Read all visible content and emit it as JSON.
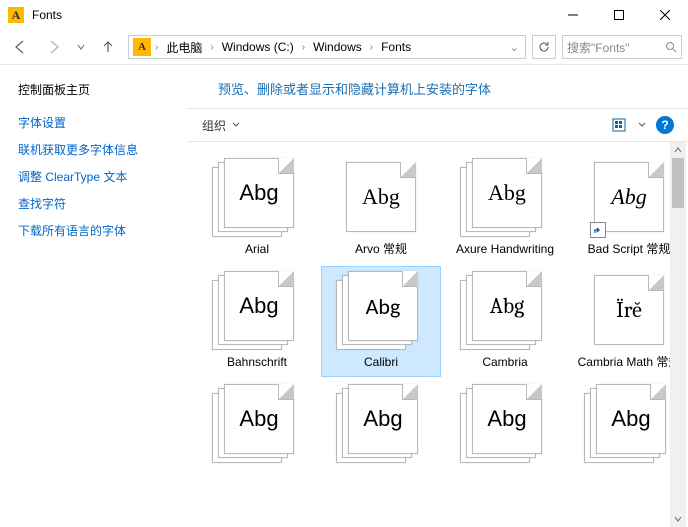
{
  "window": {
    "title": "Fonts",
    "icon_letter": "A"
  },
  "breadcrumbs": [
    "此电脑",
    "Windows (C:)",
    "Windows",
    "Fonts"
  ],
  "search": {
    "placeholder": "搜索\"Fonts\""
  },
  "sidebar": {
    "home": "控制面板主页",
    "links": [
      "字体设置",
      "联机获取更多字体信息",
      "调整 ClearType 文本",
      "查找字符",
      "下载所有语言的字体"
    ]
  },
  "headline": "预览、删除或者显示和隐藏计算机上安装的字体",
  "toolbar": {
    "organize": "组织"
  },
  "fonts": [
    {
      "name": "Arial",
      "sample": "Abg",
      "stack": true,
      "style": "normal",
      "font": "Arial, sans-serif"
    },
    {
      "name": "Arvo 常规",
      "sample": "Abg",
      "stack": false,
      "style": "normal",
      "font": "Georgia, serif"
    },
    {
      "name": "Axure Handwriting",
      "sample": "Abg",
      "stack": true,
      "style": "normal",
      "font": "'Comic Sans MS', cursive"
    },
    {
      "name": "Bad Script 常规",
      "sample": "Abg",
      "stack": false,
      "style": "italic",
      "font": "'Brush Script MT','Segoe Script',cursive",
      "shortcut": true
    },
    {
      "name": "Bahnschrift",
      "sample": "Abg",
      "stack": true,
      "style": "normal",
      "font": "'Bahnschrift','Segoe UI',sans-serif"
    },
    {
      "name": "Calibri",
      "sample": "Abg",
      "stack": true,
      "style": "normal",
      "font": "Calibri, sans-serif",
      "selected": true
    },
    {
      "name": "Cambria",
      "sample": "Abg",
      "stack": true,
      "style": "normal",
      "font": "Cambria, serif"
    },
    {
      "name": "Cambria Math 常规",
      "sample": "Ïrĕ",
      "stack": false,
      "style": "normal",
      "font": "'Cambria Math', Cambria, serif"
    },
    {
      "name": "",
      "sample": "Abg",
      "stack": true,
      "style": "normal",
      "font": "sans-serif"
    },
    {
      "name": "",
      "sample": "Abg",
      "stack": true,
      "style": "normal",
      "font": "sans-serif"
    },
    {
      "name": "",
      "sample": "Abg",
      "stack": true,
      "style": "normal",
      "font": "sans-serif"
    },
    {
      "name": "",
      "sample": "Abg",
      "stack": true,
      "style": "normal",
      "font": "sans-serif"
    }
  ]
}
